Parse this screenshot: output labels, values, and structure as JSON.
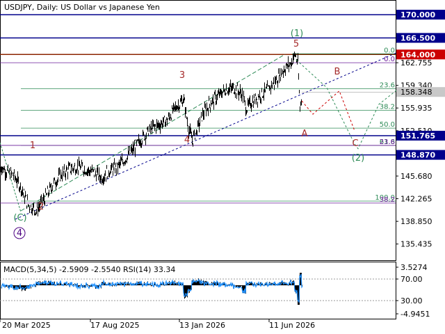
{
  "header": {
    "symbol_line": "USDJPY, Daily:  US Dollar vs Japanese Yen"
  },
  "chart_data": {
    "type": "candlestick",
    "symbol": "USDJPY",
    "timeframe": "Daily",
    "description": "US Dollar vs Japanese Yen",
    "ylim": [
      133.2,
      172.0
    ],
    "x_ticks": [
      "20 Mar 2025",
      "17 Aug 2025",
      "13 Jan 2026",
      "11 Jun 2026"
    ],
    "price_scale": [
      "170.000",
      "166.500",
      "164.000",
      "162.755",
      "158.348",
      "155.935",
      "151.765",
      "148.870",
      "142.265",
      "138.850",
      "135.435"
    ],
    "price_ticks": [
      {
        "value": 170.0,
        "label": "170.000",
        "style": "badge",
        "color": "#00008b"
      },
      {
        "value": 166.5,
        "label": "166.500",
        "style": "badge",
        "color": "#00008b"
      },
      {
        "value": 164.0,
        "label": "164.000",
        "style": "badge",
        "color": "#cc0000"
      },
      {
        "value": 162.755,
        "label": "162.755",
        "style": "plain"
      },
      {
        "value": 159.34,
        "label": "159.340",
        "style": "plain"
      },
      {
        "value": 158.348,
        "label": "158.348",
        "style": "grey"
      },
      {
        "value": 155.935,
        "label": "155.935",
        "style": "plain"
      },
      {
        "value": 152.51,
        "label": "152.510",
        "style": "plain"
      },
      {
        "value": 151.765,
        "label": "151.765",
        "style": "badge",
        "color": "#00008b"
      },
      {
        "value": 148.87,
        "label": "148.870",
        "style": "badge",
        "color": "#00008b"
      },
      {
        "value": 145.68,
        "label": "145.680",
        "style": "plain"
      },
      {
        "value": 142.265,
        "label": "142.265",
        "style": "plain"
      },
      {
        "value": 138.85,
        "label": "138.850",
        "style": "plain"
      },
      {
        "value": 135.435,
        "label": "135.435",
        "style": "plain"
      }
    ],
    "levels": [
      {
        "value": 170.0,
        "color": "#00008b"
      },
      {
        "value": 166.5,
        "color": "#00008b"
      },
      {
        "value": 164.0,
        "color": "#8b2500"
      },
      {
        "value": 151.765,
        "color": "#00008b"
      },
      {
        "value": 148.87,
        "color": "#00008b"
      }
    ],
    "fib_right": [
      {
        "label": "0.0",
        "value": 164.1
      },
      {
        "label": "23.6",
        "value": 158.85
      },
      {
        "label": "38.2",
        "value": 155.6
      },
      {
        "label": "50.0",
        "value": 152.9
      },
      {
        "label": "61.8",
        "value": 150.3
      },
      {
        "label": "100.0",
        "value": 141.9
      }
    ],
    "fib_left": [
      {
        "label": "0.0",
        "value": 162.76
      },
      {
        "label": "23.6",
        "value": 150.3
      },
      {
        "label": "38.2",
        "value": 141.6
      }
    ],
    "wave_labels": [
      {
        "text": "1",
        "color": "#a52a2a"
      },
      {
        "text": "2",
        "color": "#a52a2a"
      },
      {
        "text": "3",
        "color": "#a52a2a"
      },
      {
        "text": "4",
        "color": "#a52a2a"
      },
      {
        "text": "5",
        "color": "#a52a2a"
      },
      {
        "text": "(1)",
        "color": "#2e8b57"
      },
      {
        "text": "(2)",
        "color": "#2e8b57"
      },
      {
        "text": "(C)",
        "color": "#2e8b57"
      },
      {
        "text": "4",
        "color": "#4b0082"
      },
      {
        "text": "A",
        "color": "#a52a2a"
      },
      {
        "text": "B",
        "color": "#a52a2a"
      },
      {
        "text": "C",
        "color": "#a52a2a"
      }
    ],
    "series": [
      {
        "name": "USDJPY",
        "path": [
          [
            0,
            147.2
          ],
          [
            10,
            146.3
          ],
          [
            20,
            145.7
          ],
          [
            30,
            143.9
          ],
          [
            40,
            141.4
          ],
          [
            52,
            140.5
          ],
          [
            64,
            142.3
          ],
          [
            76,
            144.5
          ],
          [
            88,
            145.9
          ],
          [
            100,
            146.8
          ],
          [
            112,
            147.1
          ],
          [
            124,
            146.6
          ],
          [
            136,
            146.2
          ],
          [
            146,
            145.4
          ],
          [
            156,
            146.5
          ],
          [
            168,
            147.0
          ],
          [
            180,
            148.3
          ],
          [
            192,
            149.8
          ],
          [
            204,
            151.4
          ],
          [
            216,
            152.8
          ],
          [
            228,
            153.4
          ],
          [
            240,
            154.1
          ],
          [
            252,
            156.0
          ],
          [
            264,
            157.2
          ],
          [
            270,
            153.2
          ],
          [
            276,
            151.1
          ],
          [
            282,
            152.4
          ],
          [
            290,
            154.7
          ],
          [
            300,
            156.4
          ],
          [
            312,
            157.6
          ],
          [
            324,
            158.7
          ],
          [
            336,
            158.9
          ],
          [
            348,
            158.0
          ],
          [
            354,
            155.8
          ],
          [
            360,
            156.6
          ],
          [
            372,
            157.8
          ],
          [
            384,
            158.6
          ],
          [
            396,
            160.0
          ],
          [
            408,
            161.8
          ],
          [
            418,
            162.7
          ],
          [
            424,
            164.0
          ],
          [
            428,
            162.6
          ],
          [
            431,
            155.8
          ],
          [
            434,
            158.3
          ]
        ]
      }
    ],
    "forecast_paths": [
      {
        "name": "green",
        "color": "#2e8b57",
        "points": [
          [
            426,
            163.2
          ],
          [
            470,
            159.0
          ],
          [
            510,
            150.5
          ],
          [
            515,
            149.8
          ],
          [
            545,
            156.5
          ],
          [
            575,
            159.0
          ]
        ]
      },
      {
        "name": "red",
        "color": "#cc0000",
        "points": [
          [
            434,
            157.0
          ],
          [
            450,
            155.0
          ],
          [
            488,
            158.5
          ],
          [
            510,
            152.5
          ]
        ]
      }
    ],
    "indicator": {
      "title": "MACD(5,34,5) -2.5909 -2.5540 RSI(14) 33.34",
      "macd_params": "5,34,5",
      "macd": -2.5909,
      "signal": -2.554,
      "rsi": 33.34,
      "axis_labels": [
        "3.5274",
        "70.00",
        "30.00",
        "-4.9451"
      ]
    }
  }
}
